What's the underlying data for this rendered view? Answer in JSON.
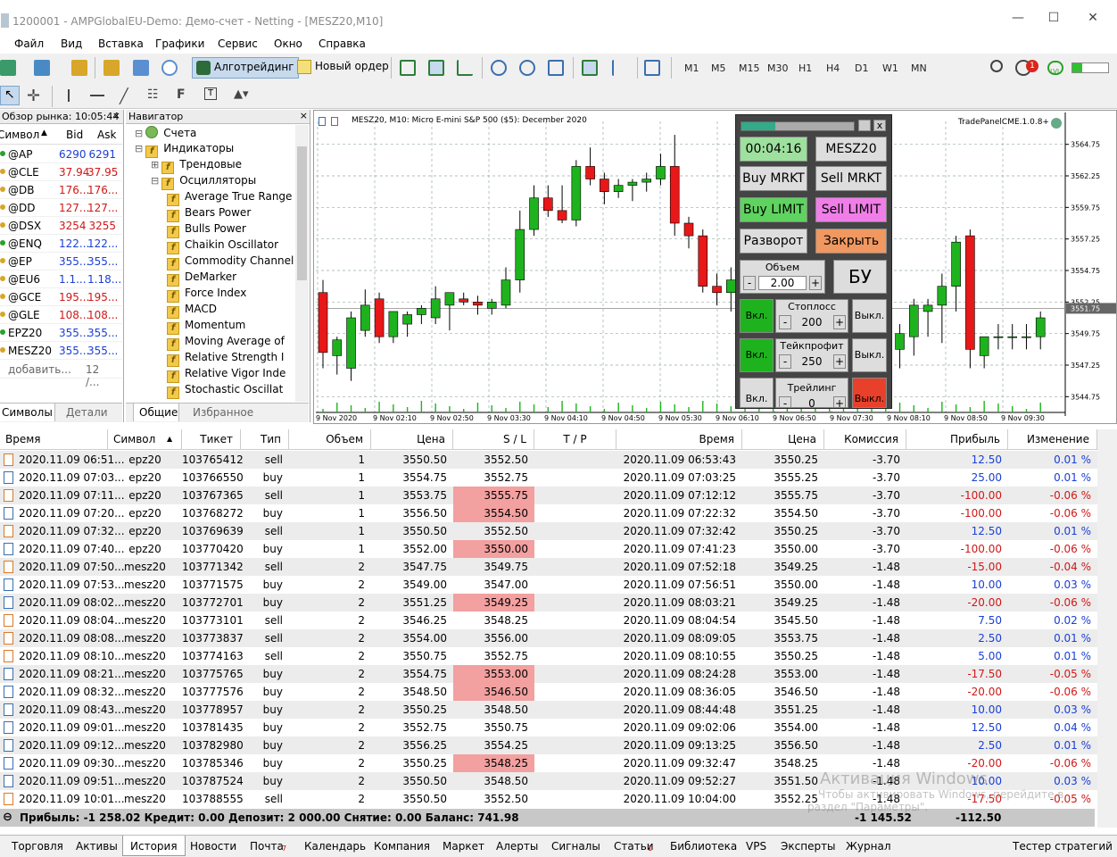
{
  "window": {
    "title": "1200001 - AMPGlobalEU-Demo: Демо-счет - Netting - [MESZ20,M10]"
  },
  "menu": [
    "Файл",
    "Вид",
    "Вставка",
    "Графики",
    "Сервис",
    "Окно",
    "Справка"
  ],
  "toolbar": {
    "algo": "Алготрейдинг",
    "new_order": "Новый ордер",
    "timeframes": [
      "M1",
      "M5",
      "M15",
      "M30",
      "H1",
      "H4",
      "D1",
      "W1",
      "MN"
    ],
    "notify_count": "1",
    "lvl": "LVL"
  },
  "market_watch": {
    "title": "Обзор рынка: 10:05:44",
    "cols": [
      "Символ",
      "Bid",
      "Ask"
    ],
    "rows": [
      {
        "s": "@AP",
        "b": "6290",
        "a": "6291",
        "c": "blue"
      },
      {
        "s": "@CLE",
        "b": "37.94",
        "a": "37.95",
        "c": "red"
      },
      {
        "s": "@DB",
        "b": "176...",
        "a": "176...",
        "c": "red"
      },
      {
        "s": "@DD",
        "b": "127...",
        "a": "127...",
        "c": "red"
      },
      {
        "s": "@DSX",
        "b": "3254",
        "a": "3255",
        "c": "red"
      },
      {
        "s": "@ENQ",
        "b": "122...",
        "a": "122...",
        "c": "blue"
      },
      {
        "s": "@EP",
        "b": "355...",
        "a": "355...",
        "c": "blue"
      },
      {
        "s": "@EU6",
        "b": "1.1...",
        "a": "1.18...",
        "c": "blue"
      },
      {
        "s": "@GCE",
        "b": "195...",
        "a": "195...",
        "c": "red"
      },
      {
        "s": "@GLE",
        "b": "108...",
        "a": "108...",
        "c": "red"
      },
      {
        "s": "EPZ20",
        "b": "355...",
        "a": "355...",
        "c": "blue"
      },
      {
        "s": "MESZ20",
        "b": "355...",
        "a": "355...",
        "c": "blue"
      }
    ],
    "add": "добавить...",
    "count": "12 /...",
    "tabs": [
      "Символы",
      "Детали"
    ]
  },
  "navigator": {
    "title": "Навигатор",
    "items": [
      {
        "t": "Счета",
        "lvl": 0
      },
      {
        "t": "Индикаторы",
        "lvl": 0
      },
      {
        "t": "Трендовые",
        "lvl": 1
      },
      {
        "t": "Осцилляторы",
        "lvl": 1
      },
      {
        "t": "Average True Range",
        "lvl": 2
      },
      {
        "t": "Bears Power",
        "lvl": 2
      },
      {
        "t": "Bulls Power",
        "lvl": 2
      },
      {
        "t": "Chaikin Oscillator",
        "lvl": 2
      },
      {
        "t": "Commodity Channel",
        "lvl": 2
      },
      {
        "t": "DeMarker",
        "lvl": 2
      },
      {
        "t": "Force Index",
        "lvl": 2
      },
      {
        "t": "MACD",
        "lvl": 2
      },
      {
        "t": "Momentum",
        "lvl": 2
      },
      {
        "t": "Moving Average of",
        "lvl": 2
      },
      {
        "t": "Relative Strength I",
        "lvl": 2
      },
      {
        "t": "Relative Vigor Inde",
        "lvl": 2
      },
      {
        "t": "Stochastic Oscillat",
        "lvl": 2
      }
    ],
    "tabs": [
      "Общие",
      "Избранное"
    ]
  },
  "chart": {
    "header": "MESZ20, M10:  Micro E-mini S&P 500 ($5): December 2020",
    "tradepanel_label": "TradePanelCME.1.0.8+",
    "price_labels": [
      "3564.75",
      "3562.25",
      "3559.75",
      "3557.25",
      "3554.75",
      "3552.25",
      "3549.75",
      "3547.25",
      "3544.75"
    ],
    "current_price": "3551.75",
    "time_labels": [
      "9 Nov 2020",
      "9 Nov 02:10",
      "9 Nov 02:50",
      "9 Nov 03:30",
      "9 Nov 04:10",
      "9 Nov 04:50",
      "9 Nov 05:30",
      "9 Nov 06:10",
      "9 Nov 06:50",
      "9 Nov 07:30",
      "9 Nov 08:10",
      "9 Nov 08:50",
      "9 Nov 09:30"
    ]
  },
  "chart_data": {
    "type": "candlestick",
    "ylim": [
      3543.5,
      3566
    ],
    "candles": [
      {
        "o": 3553.0,
        "h": 3554.0,
        "l": 3547.0,
        "c": 3548.25
      },
      {
        "o": 3548.0,
        "h": 3549.5,
        "l": 3546.5,
        "c": 3549.25
      },
      {
        "o": 3547.0,
        "h": 3551.5,
        "l": 3546.0,
        "c": 3551.0
      },
      {
        "o": 3550.0,
        "h": 3553.25,
        "l": 3549.5,
        "c": 3552.0
      },
      {
        "o": 3552.5,
        "h": 3553.0,
        "l": 3549.0,
        "c": 3549.5
      },
      {
        "o": 3549.5,
        "h": 3551.5,
        "l": 3549.0,
        "c": 3551.5
      },
      {
        "o": 3550.5,
        "h": 3551.5,
        "l": 3549.5,
        "c": 3551.25
      },
      {
        "o": 3551.25,
        "h": 3552.0,
        "l": 3550.5,
        "c": 3551.75
      },
      {
        "o": 3551.0,
        "h": 3553.5,
        "l": 3550.5,
        "c": 3552.5
      },
      {
        "o": 3552.0,
        "h": 3553.0,
        "l": 3550.0,
        "c": 3553.0
      },
      {
        "o": 3552.5,
        "h": 3553.0,
        "l": 3552.0,
        "c": 3552.25
      },
      {
        "o": 3552.25,
        "h": 3552.75,
        "l": 3551.25,
        "c": 3552.0
      },
      {
        "o": 3551.75,
        "h": 3552.5,
        "l": 3551.25,
        "c": 3552.25
      },
      {
        "o": 3552.0,
        "h": 3555.0,
        "l": 3551.75,
        "c": 3554.0
      },
      {
        "o": 3554.0,
        "h": 3559.5,
        "l": 3553.0,
        "c": 3558.0
      },
      {
        "o": 3558.0,
        "h": 3561.5,
        "l": 3557.5,
        "c": 3560.5
      },
      {
        "o": 3560.5,
        "h": 3561.5,
        "l": 3559.0,
        "c": 3559.5
      },
      {
        "o": 3559.5,
        "h": 3561.5,
        "l": 3558.5,
        "c": 3558.75
      },
      {
        "o": 3558.75,
        "h": 3563.5,
        "l": 3558.25,
        "c": 3563.0
      },
      {
        "o": 3563.0,
        "h": 3564.5,
        "l": 3561.5,
        "c": 3562.0
      },
      {
        "o": 3562.0,
        "h": 3562.5,
        "l": 3560.0,
        "c": 3561.0
      },
      {
        "o": 3561.0,
        "h": 3562.0,
        "l": 3560.5,
        "c": 3561.5
      },
      {
        "o": 3561.5,
        "h": 3562.0,
        "l": 3560.25,
        "c": 3561.75
      },
      {
        "o": 3561.75,
        "h": 3562.5,
        "l": 3561.0,
        "c": 3562.0
      },
      {
        "o": 3562.0,
        "h": 3564.0,
        "l": 3561.5,
        "c": 3563.0
      },
      {
        "o": 3563.0,
        "h": 3565.5,
        "l": 3557.5,
        "c": 3558.5
      },
      {
        "o": 3558.5,
        "h": 3559.0,
        "l": 3556.5,
        "c": 3557.5
      },
      {
        "o": 3557.5,
        "h": 3558.0,
        "l": 3553.0,
        "c": 3553.5
      },
      {
        "o": 3553.5,
        "h": 3554.5,
        "l": 3552.0,
        "c": 3553.0
      },
      {
        "o": 3553.0,
        "h": 3555.0,
        "l": 3551.5,
        "c": 3554.0
      },
      {
        "o": 3554.0,
        "h": 3555.0,
        "l": 3551.0,
        "c": 3552.5
      },
      {
        "o": 3552.5,
        "h": 3554.0,
        "l": 3550.5,
        "c": 3553.0
      },
      {
        "o": 3553.0,
        "h": 3554.0,
        "l": 3550.5,
        "c": 3551.5
      },
      {
        "o": 3551.5,
        "h": 3553.0,
        "l": 3549.5,
        "c": 3552.0
      },
      {
        "o": 3552.0,
        "h": 3553.0,
        "l": 3550.0,
        "c": 3551.0
      },
      {
        "o": 3551.0,
        "h": 3552.5,
        "l": 3549.5,
        "c": 3550.5
      },
      {
        "o": 3550.5,
        "h": 3551.5,
        "l": 3548.5,
        "c": 3549.5
      },
      {
        "o": 3549.5,
        "h": 3550.5,
        "l": 3548.0,
        "c": 3550.0
      },
      {
        "o": 3550.0,
        "h": 3550.5,
        "l": 3547.5,
        "c": 3548.5
      },
      {
        "o": 3548.5,
        "h": 3554.0,
        "l": 3547.0,
        "c": 3553.5
      },
      {
        "o": 3553.5,
        "h": 3554.5,
        "l": 3547.0,
        "c": 3548.5
      },
      {
        "o": 3548.5,
        "h": 3550.5,
        "l": 3547.0,
        "c": 3549.75
      },
      {
        "o": 3549.5,
        "h": 3552.5,
        "l": 3548.0,
        "c": 3552.0
      },
      {
        "o": 3551.5,
        "h": 3552.5,
        "l": 3549.5,
        "c": 3552.0
      },
      {
        "o": 3552.0,
        "h": 3554.5,
        "l": 3549.0,
        "c": 3553.5
      },
      {
        "o": 3553.5,
        "h": 3557.5,
        "l": 3551.5,
        "c": 3557.0
      },
      {
        "o": 3557.5,
        "h": 3558.0,
        "l": 3547.0,
        "c": 3548.5
      },
      {
        "o": 3548.0,
        "h": 3549.5,
        "l": 3547.0,
        "c": 3549.5
      },
      {
        "o": 3549.5,
        "h": 3550.5,
        "l": 3548.5,
        "c": 3549.5
      },
      {
        "o": 3549.5,
        "h": 3550.5,
        "l": 3548.5,
        "c": 3549.5
      },
      {
        "o": 3549.5,
        "h": 3550.5,
        "l": 3548.5,
        "c": 3549.5
      },
      {
        "o": 3549.5,
        "h": 3551.5,
        "l": 3548.5,
        "c": 3551.0
      }
    ]
  },
  "tradepanel": {
    "timer": "00:04:16",
    "symbol": "MESZ20",
    "buy_mrkt": "Buy MRKT",
    "sell_mrkt": "Sell MRKT",
    "buy_limit": "Buy LIMIT",
    "sell_limit": "Sell LIMIT",
    "reverse": "Разворот",
    "close": "Закрыть",
    "volume_label": "Объем",
    "volume": "2.00",
    "minus": "-",
    "plus": "+",
    "bu": "БУ",
    "sl_label": "Стоплосс",
    "sl": "200",
    "tp_label": "Тейкпрофит",
    "tp": "250",
    "trail_label": "Трейлинг",
    "trail": "0",
    "on": "Вкл.",
    "off": "Выкл.",
    "x": "x"
  },
  "history": {
    "cols": [
      "Время",
      "Символ",
      "Тикет",
      "Тип",
      "Объем",
      "Цена",
      "S / L",
      "T / P",
      "Время",
      "Цена",
      "Комиссия",
      "Прибыль",
      "Изменение"
    ],
    "rows": [
      [
        "2020.11.09 06:51...",
        "epz20",
        "103765412",
        "sell",
        "1",
        "3550.50",
        "3552.50",
        "",
        "2020.11.09 06:53:43",
        "3550.25",
        "-3.70",
        "12.50",
        "0.01 %"
      ],
      [
        "2020.11.09 07:03...",
        "epz20",
        "103766550",
        "buy",
        "1",
        "3554.75",
        "3552.75",
        "",
        "2020.11.09 07:03:25",
        "3555.25",
        "-3.70",
        "25.00",
        "0.01 %"
      ],
      [
        "2020.11.09 07:11...",
        "epz20",
        "103767365",
        "sell",
        "1",
        "3553.75",
        "3555.75",
        "",
        "2020.11.09 07:12:12",
        "3555.75",
        "-3.70",
        "-100.00",
        "-0.06 %"
      ],
      [
        "2020.11.09 07:20...",
        "epz20",
        "103768272",
        "buy",
        "1",
        "3556.50",
        "3554.50",
        "",
        "2020.11.09 07:22:32",
        "3554.50",
        "-3.70",
        "-100.00",
        "-0.06 %"
      ],
      [
        "2020.11.09 07:32...",
        "epz20",
        "103769639",
        "sell",
        "1",
        "3550.50",
        "3552.50",
        "",
        "2020.11.09 07:32:42",
        "3550.25",
        "-3.70",
        "12.50",
        "0.01 %"
      ],
      [
        "2020.11.09 07:40...",
        "epz20",
        "103770420",
        "buy",
        "1",
        "3552.00",
        "3550.00",
        "",
        "2020.11.09 07:41:23",
        "3550.00",
        "-3.70",
        "-100.00",
        "-0.06 %"
      ],
      [
        "2020.11.09 07:50...",
        "mesz20",
        "103771342",
        "sell",
        "2",
        "3547.75",
        "3549.75",
        "",
        "2020.11.09 07:52:18",
        "3549.25",
        "-1.48",
        "-15.00",
        "-0.04 %"
      ],
      [
        "2020.11.09 07:53...",
        "mesz20",
        "103771575",
        "buy",
        "2",
        "3549.00",
        "3547.00",
        "",
        "2020.11.09 07:56:51",
        "3550.00",
        "-1.48",
        "10.00",
        "0.03 %"
      ],
      [
        "2020.11.09 08:02...",
        "mesz20",
        "103772701",
        "buy",
        "2",
        "3551.25",
        "3549.25",
        "",
        "2020.11.09 08:03:21",
        "3549.25",
        "-1.48",
        "-20.00",
        "-0.06 %"
      ],
      [
        "2020.11.09 08:04...",
        "mesz20",
        "103773101",
        "sell",
        "2",
        "3546.25",
        "3548.25",
        "",
        "2020.11.09 08:04:54",
        "3545.50",
        "-1.48",
        "7.50",
        "0.02 %"
      ],
      [
        "2020.11.09 08:08...",
        "mesz20",
        "103773837",
        "sell",
        "2",
        "3554.00",
        "3556.00",
        "",
        "2020.11.09 08:09:05",
        "3553.75",
        "-1.48",
        "2.50",
        "0.01 %"
      ],
      [
        "2020.11.09 08:10...",
        "mesz20",
        "103774163",
        "sell",
        "2",
        "3550.75",
        "3552.75",
        "",
        "2020.11.09 08:10:55",
        "3550.25",
        "-1.48",
        "5.00",
        "0.01 %"
      ],
      [
        "2020.11.09 08:21...",
        "mesz20",
        "103775765",
        "buy",
        "2",
        "3554.75",
        "3553.00",
        "",
        "2020.11.09 08:24:28",
        "3553.00",
        "-1.48",
        "-17.50",
        "-0.05 %"
      ],
      [
        "2020.11.09 08:32...",
        "mesz20",
        "103777576",
        "buy",
        "2",
        "3548.50",
        "3546.50",
        "",
        "2020.11.09 08:36:05",
        "3546.50",
        "-1.48",
        "-20.00",
        "-0.06 %"
      ],
      [
        "2020.11.09 08:43...",
        "mesz20",
        "103778957",
        "buy",
        "2",
        "3550.25",
        "3548.50",
        "",
        "2020.11.09 08:44:48",
        "3551.25",
        "-1.48",
        "10.00",
        "0.03 %"
      ],
      [
        "2020.11.09 09:01...",
        "mesz20",
        "103781435",
        "buy",
        "2",
        "3552.75",
        "3550.75",
        "",
        "2020.11.09 09:02:06",
        "3554.00",
        "-1.48",
        "12.50",
        "0.04 %"
      ],
      [
        "2020.11.09 09:12...",
        "mesz20",
        "103782980",
        "buy",
        "2",
        "3556.25",
        "3554.25",
        "",
        "2020.11.09 09:13:25",
        "3556.50",
        "-1.48",
        "2.50",
        "0.01 %"
      ],
      [
        "2020.11.09 09:30...",
        "mesz20",
        "103785346",
        "buy",
        "2",
        "3550.25",
        "3548.25",
        "",
        "2020.11.09 09:32:47",
        "3548.25",
        "-1.48",
        "-20.00",
        "-0.06 %"
      ],
      [
        "2020.11.09 09:51...",
        "mesz20",
        "103787524",
        "buy",
        "2",
        "3550.50",
        "3548.50",
        "",
        "2020.11.09 09:52:27",
        "3551.50",
        "-1.48",
        "10.00",
        "0.03 %"
      ],
      [
        "2020.11.09 10:01...",
        "mesz20",
        "103788555",
        "sell",
        "2",
        "3550.50",
        "3552.50",
        "",
        "2020.11.09 10:04:00",
        "3552.25",
        "-1.48",
        "-17.50",
        "-0.05 %"
      ]
    ],
    "sl_hit": [
      2,
      3,
      5,
      8,
      12,
      13,
      17
    ],
    "summary": {
      "text": "Прибыль: -1 258.02  Кредит: 0.00  Депозит: 2 000.00  Снятие: 0.00  Баланс: 741.98",
      "commission": "-1 145.52",
      "profit": "-112.50"
    }
  },
  "watermark": {
    "line1": "Активация Windows",
    "line2": "Чтобы активировать Windows, перейдите в",
    "line3": "раздел \"Параметры\"."
  },
  "bottom_tabs": [
    "Торговля",
    "Активы",
    "История",
    "Новости",
    "Почта",
    "Календарь",
    "Компания",
    "Маркет",
    "Алерты",
    "Сигналы",
    "Статьи",
    "Библиотека",
    "VPS",
    "Эксперты",
    "Журнал"
  ],
  "bottom_badges": {
    "mail": "7",
    "articles": "1"
  },
  "tester": "Тестер стратегий"
}
